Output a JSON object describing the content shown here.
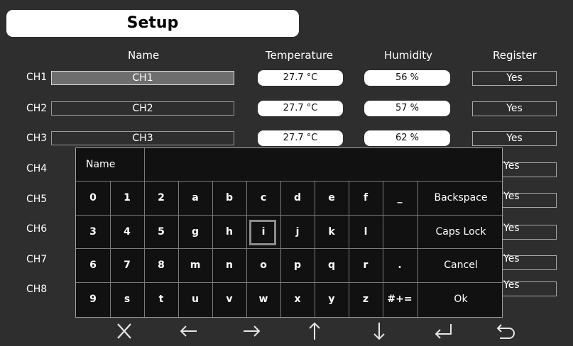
{
  "title": "Setup",
  "columns": {
    "name": "Name",
    "temperature": "Temperature",
    "humidity": "Humidity",
    "register": "Register"
  },
  "channels": [
    {
      "label": "CH1",
      "name": "CH1",
      "temperature": "27.7 °C",
      "humidity": "56 %",
      "register": "Yes"
    },
    {
      "label": "CH2",
      "name": "CH2",
      "temperature": "27.7 °C",
      "humidity": "57 %",
      "register": "Yes"
    },
    {
      "label": "CH3",
      "name": "CH3",
      "temperature": "27.7 °C",
      "humidity": "62 %",
      "register": "Yes"
    },
    {
      "label": "CH4",
      "register": "Yes"
    },
    {
      "label": "CH5",
      "register": "Yes"
    },
    {
      "label": "CH6",
      "register": "Yes"
    },
    {
      "label": "CH7",
      "register": "Yes"
    },
    {
      "label": "CH8",
      "register": "Yes"
    }
  ],
  "keyboard": {
    "name_label": "Name",
    "name_value": "",
    "rows": [
      [
        "0",
        "1",
        "2",
        "a",
        "b",
        "c",
        "d",
        "e",
        "f",
        "_"
      ],
      [
        "3",
        "4",
        "5",
        "g",
        "h",
        "i",
        "j",
        "k",
        "l",
        ""
      ],
      [
        "6",
        "7",
        "8",
        "m",
        "n",
        "o",
        "p",
        "q",
        "r",
        "."
      ],
      [
        "9",
        "s",
        "t",
        "u",
        "v",
        "w",
        "x",
        "y",
        "z",
        "#+="
      ]
    ],
    "selected_key": "i",
    "actions": [
      "Backspace",
      "Caps Lock",
      "Cancel",
      "Ok"
    ]
  },
  "nav_icons": [
    "close-icon",
    "arrow-left-icon",
    "arrow-right-icon",
    "arrow-up-icon",
    "arrow-down-icon",
    "enter-icon",
    "back-icon"
  ]
}
